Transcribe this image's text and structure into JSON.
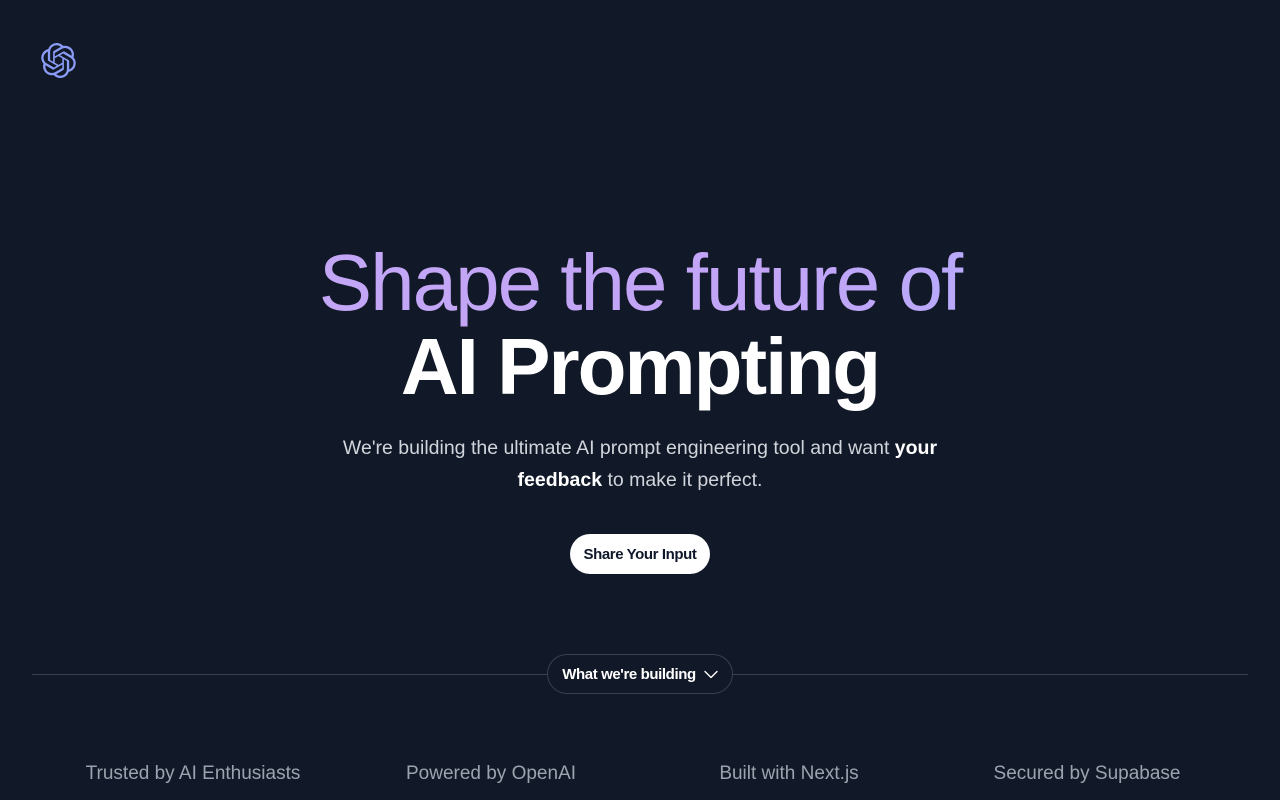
{
  "brand": {
    "logo_icon": "openai-logo-icon",
    "logo_color": "#8b9cf7"
  },
  "hero": {
    "headline_line1": "Shape the future of",
    "headline_line2": "AI Prompting",
    "subtitle_pre": "We're building the ultimate AI prompt engineering tool and want ",
    "subtitle_emphasis": "your feedback",
    "subtitle_post": " to make it perfect.",
    "cta_label": "Share Your Input"
  },
  "section_toggle": {
    "label": "What we're building",
    "icon": "chevron-down-icon"
  },
  "badges": [
    "Trusted by AI Enthusiasts",
    "Powered by OpenAI",
    "Built with Next.js",
    "Secured by Supabase"
  ],
  "colors": {
    "background": "#111827",
    "headline_gradient_start": "#c4a6f5",
    "headline_gradient_end": "#a9b0ff",
    "cta_background": "#ffffff",
    "muted_text": "#9ca3af"
  }
}
